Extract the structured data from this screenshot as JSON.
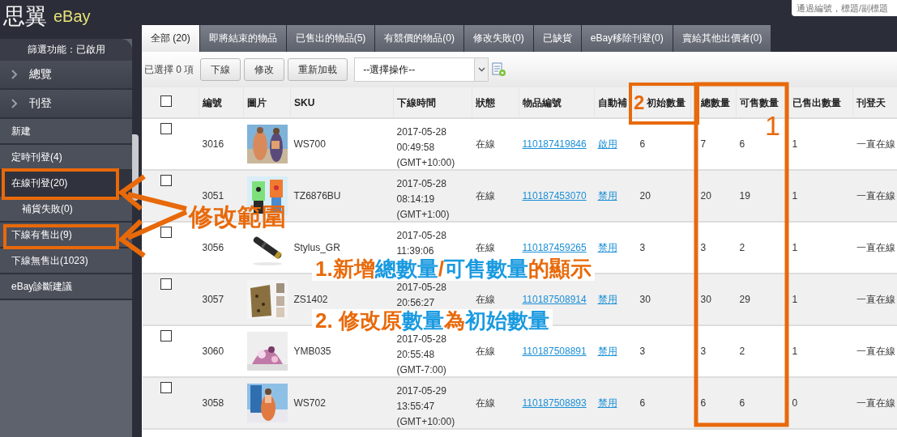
{
  "logo": {
    "mark": "思翼",
    "name": "eBay"
  },
  "search": {
    "placeholder": "通過編號，標題/副標題"
  },
  "filter_status": "篩選功能：已啟用",
  "sidebar": {
    "items": [
      {
        "kind": "section",
        "label": "總覽",
        "selected": false
      },
      {
        "kind": "section",
        "label": "刊登",
        "selected": false
      },
      {
        "kind": "item",
        "label": "新建",
        "selected": false
      },
      {
        "kind": "item",
        "label": "定時刊登(4)",
        "selected": false
      },
      {
        "kind": "item",
        "label": "在線刊登(20)",
        "selected": true
      },
      {
        "kind": "subitem",
        "label": "補貨失敗(0)",
        "selected": false
      },
      {
        "kind": "item",
        "label": "下線有售出(9)",
        "selected": false
      },
      {
        "kind": "item",
        "label": "下線無售出(1023)",
        "selected": false
      },
      {
        "kind": "item",
        "label": "eBay診斷建議",
        "selected": false
      }
    ]
  },
  "tabs": [
    {
      "label": "全部 (20)",
      "selected": true
    },
    {
      "label": "即將結束的物品",
      "selected": false
    },
    {
      "label": "已售出的物品(5)",
      "selected": false
    },
    {
      "label": "有競價的物品(0)",
      "selected": false
    },
    {
      "label": "修改失敗(0)",
      "selected": false
    },
    {
      "label": "已缺貨",
      "selected": false
    },
    {
      "label": "eBay移除刊登(0)",
      "selected": false
    },
    {
      "label": "賣給其他出價者(0)",
      "selected": false
    }
  ],
  "toolbar": {
    "selection_count": "已選擇 0 項",
    "buttons": [
      "下線",
      "修改",
      "重新加載"
    ],
    "action_select": {
      "value": "--選擇操作--"
    }
  },
  "table": {
    "header_checked": false,
    "columns": [
      "編號",
      "圖片",
      "SKU",
      "下線時間",
      "狀態",
      "物品編號",
      "自動補",
      "初始數量",
      "總數量",
      "可售數量",
      "已售出數量",
      "刊登天"
    ],
    "rows": [
      {
        "checked": false,
        "number": "3016",
        "sku": "WS700",
        "offline_time": [
          "2017-05-28",
          "00:49:58",
          "(GMT+10:00)"
        ],
        "status": "在線",
        "item_number": "110187419846",
        "auto_restock": "啟用",
        "initial_qty": "6",
        "total_qty": "7",
        "available_qty": "6",
        "sold_qty": "1",
        "listing_days": "一直在線"
      },
      {
        "checked": false,
        "number": "3051",
        "sku": "TZ6876BU",
        "offline_time": [
          "2017-05-28",
          "08:14:19",
          "(GMT+1:00)"
        ],
        "status": "在線",
        "item_number": "110187453070",
        "auto_restock": "禁用",
        "initial_qty": "20",
        "total_qty": "20",
        "available_qty": "19",
        "sold_qty": "1",
        "listing_days": "一直在線"
      },
      {
        "checked": false,
        "number": "3056",
        "sku": "Stylus_GR",
        "offline_time": [
          "2017-05-28",
          "11:39:06"
        ],
        "status": "在線",
        "item_number": "110187459265",
        "auto_restock": "禁用",
        "initial_qty": "3",
        "total_qty": "3",
        "available_qty": "2",
        "sold_qty": "1",
        "listing_days": "一直在線"
      },
      {
        "checked": false,
        "number": "3057",
        "sku": "ZS1402",
        "offline_time": [
          "2017-05-28",
          "20:56:27"
        ],
        "status": "在線",
        "item_number": "110187508914",
        "auto_restock": "禁用",
        "initial_qty": "30",
        "total_qty": "30",
        "available_qty": "29",
        "sold_qty": "1",
        "listing_days": "一直在線"
      },
      {
        "checked": false,
        "number": "3060",
        "sku": "YMB035",
        "offline_time": [
          "2017-05-28",
          "20:55:48",
          "(GMT-7:00)"
        ],
        "status": "在線",
        "item_number": "110187508891",
        "auto_restock": "禁用",
        "initial_qty": "3",
        "total_qty": "3",
        "available_qty": "2",
        "sold_qty": "1",
        "listing_days": "一直在線"
      },
      {
        "checked": false,
        "number": "3058",
        "sku": "WS702",
        "offline_time": [
          "2017-05-29",
          "13:55:47",
          "(GMT+10:00)"
        ],
        "status": "在線",
        "item_number": "110187508893",
        "auto_restock": "禁用",
        "initial_qty": "6",
        "total_qty": "6",
        "available_qty": "6",
        "sold_qty": "0",
        "listing_days": "一直在線"
      }
    ]
  },
  "annotations": {
    "scope_label": "修改範圍",
    "marker_1": "1",
    "marker_2": "2",
    "notes": [
      {
        "segments": [
          {
            "text": "1.新增",
            "color": "#e8690a"
          },
          {
            "text": "總數量",
            "color": "#1a9ae0"
          },
          {
            "text": "/",
            "color": "#e8690a"
          },
          {
            "text": "可售數量",
            "color": "#1a9ae0"
          },
          {
            "text": "的顯示",
            "color": "#e8690a"
          }
        ]
      },
      {
        "segments": [
          {
            "text": "2. 修改原",
            "color": "#e8690a"
          },
          {
            "text": "數量",
            "color": "#1a9ae0"
          },
          {
            "text": "為",
            "color": "#e8690a"
          },
          {
            "text": "初始數量",
            "color": "#1a9ae0"
          }
        ]
      }
    ]
  }
}
